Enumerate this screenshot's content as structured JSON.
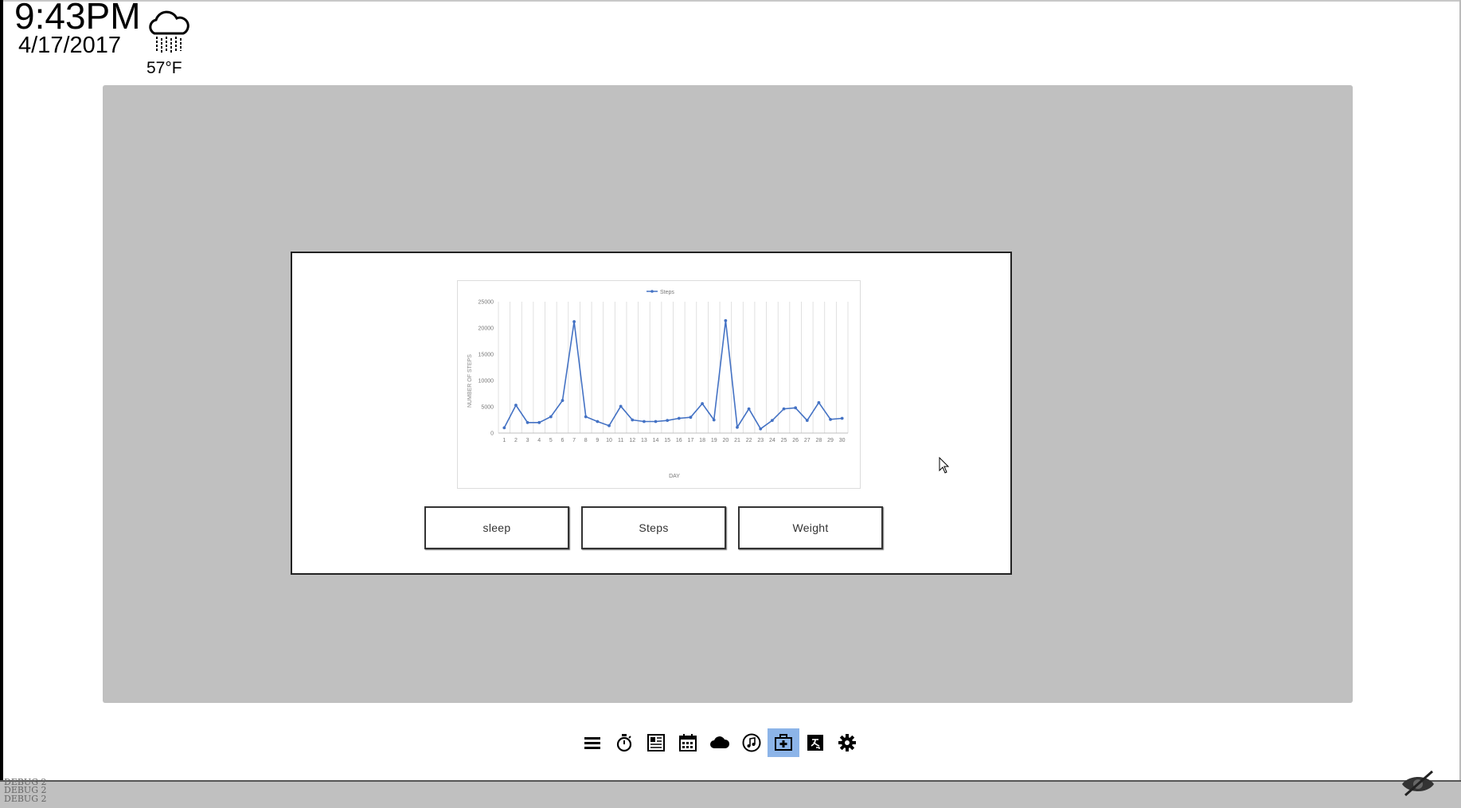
{
  "header": {
    "time": "9:43PM",
    "date": "4/17/2017",
    "weather": {
      "icon": "rain-cloud-icon",
      "temperature": "57°F"
    }
  },
  "health": {
    "buttons": [
      {
        "label": "sleep"
      },
      {
        "label": "Steps"
      },
      {
        "label": "Weight"
      }
    ]
  },
  "chart_data": {
    "type": "line",
    "title": "",
    "xlabel": "DAY",
    "ylabel": "NUMBER OF STEPS",
    "legend": {
      "entries": [
        "Steps"
      ],
      "position": "top"
    },
    "ylim": [
      0,
      25000
    ],
    "yticks": [
      0,
      5000,
      10000,
      15000,
      20000,
      25000
    ],
    "grid": "vertical",
    "color": "#4472c4",
    "x": [
      1,
      2,
      3,
      4,
      5,
      6,
      7,
      8,
      9,
      10,
      11,
      12,
      13,
      14,
      15,
      16,
      17,
      18,
      19,
      20,
      21,
      22,
      23,
      24,
      25,
      26,
      27,
      28,
      29,
      30
    ],
    "series": [
      {
        "name": "Steps",
        "values": [
          1000,
          5300,
          2000,
          2000,
          3100,
          6200,
          21200,
          3100,
          2200,
          1400,
          5100,
          2500,
          2200,
          2200,
          2400,
          2800,
          3000,
          5600,
          2500,
          21400,
          1100,
          4600,
          800,
          2400,
          4600,
          4800,
          2400,
          5800,
          2600,
          2800
        ]
      }
    ]
  },
  "dock": {
    "icons": [
      "menu-icon",
      "stopwatch-icon",
      "news-icon",
      "calendar-icon",
      "cloud-icon",
      "music-icon",
      "health-icon",
      "translate-icon",
      "settings-icon"
    ],
    "active": "health-icon"
  },
  "status": {
    "debug_lines": [
      "DEBUG 2",
      "DEBUG 2",
      "DEBUG 2"
    ]
  }
}
